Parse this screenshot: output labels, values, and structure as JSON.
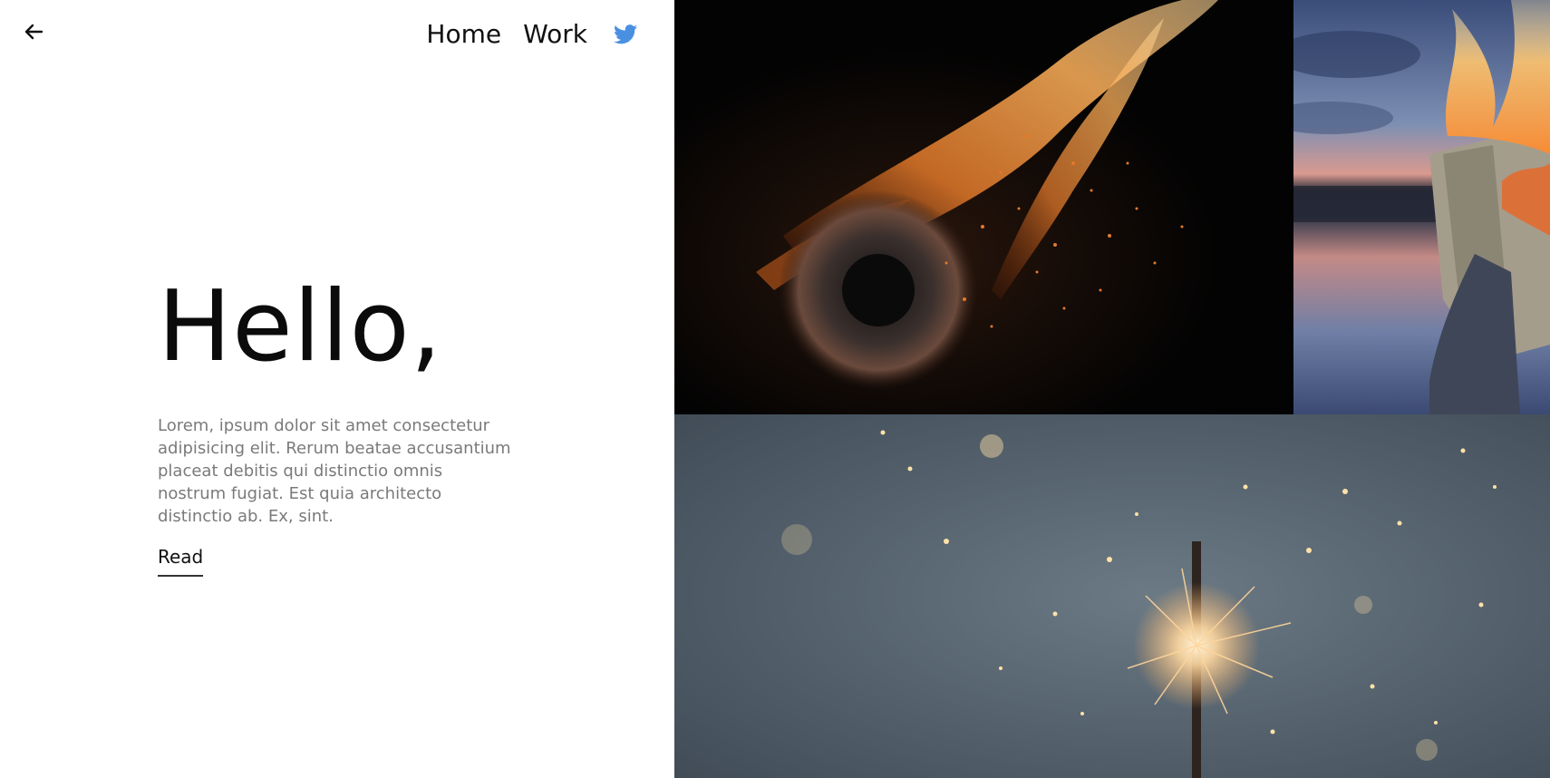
{
  "nav": {
    "back_icon": "arrow-left-icon",
    "items": [
      {
        "label": "Home"
      },
      {
        "label": "Work"
      }
    ],
    "social_icon": "twitter-icon",
    "social_color": "#4a90e2"
  },
  "hero": {
    "title": "Hello,",
    "intro": "Lorem, ipsum dolor sit amet consectetur adipisicing elit. Rerum beatae accusantium placeat debitis qui distinctio omnis nostrum fugiat. Est quia architecto distinctio ab. Ex, sint.",
    "cta_label": "Read"
  },
  "gallery": {
    "images": [
      {
        "subject": "burning-dandelion"
      },
      {
        "subject": "burning-book-lake-sunset"
      },
      {
        "subject": "sparkler-fireworks"
      }
    ]
  }
}
